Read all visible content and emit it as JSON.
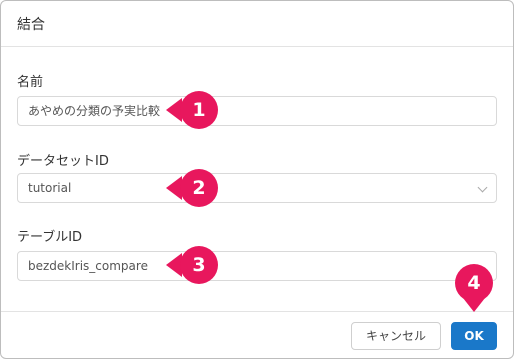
{
  "dialog": {
    "title": "結合",
    "fields": [
      {
        "label": "名前",
        "value": "あやめの分類の予実比較"
      },
      {
        "label": "データセットID",
        "value": "tutorial"
      },
      {
        "label": "テーブルID",
        "value": "bezdekIris_compare"
      }
    ],
    "buttons": {
      "cancel": "キャンセル",
      "ok": "OK"
    }
  },
  "callouts": [
    "1",
    "2",
    "3",
    "4"
  ],
  "colors": {
    "callout": "#e8175d",
    "primary": "#1a78c9"
  },
  "icons": {
    "select": "chevron-down-icon"
  }
}
